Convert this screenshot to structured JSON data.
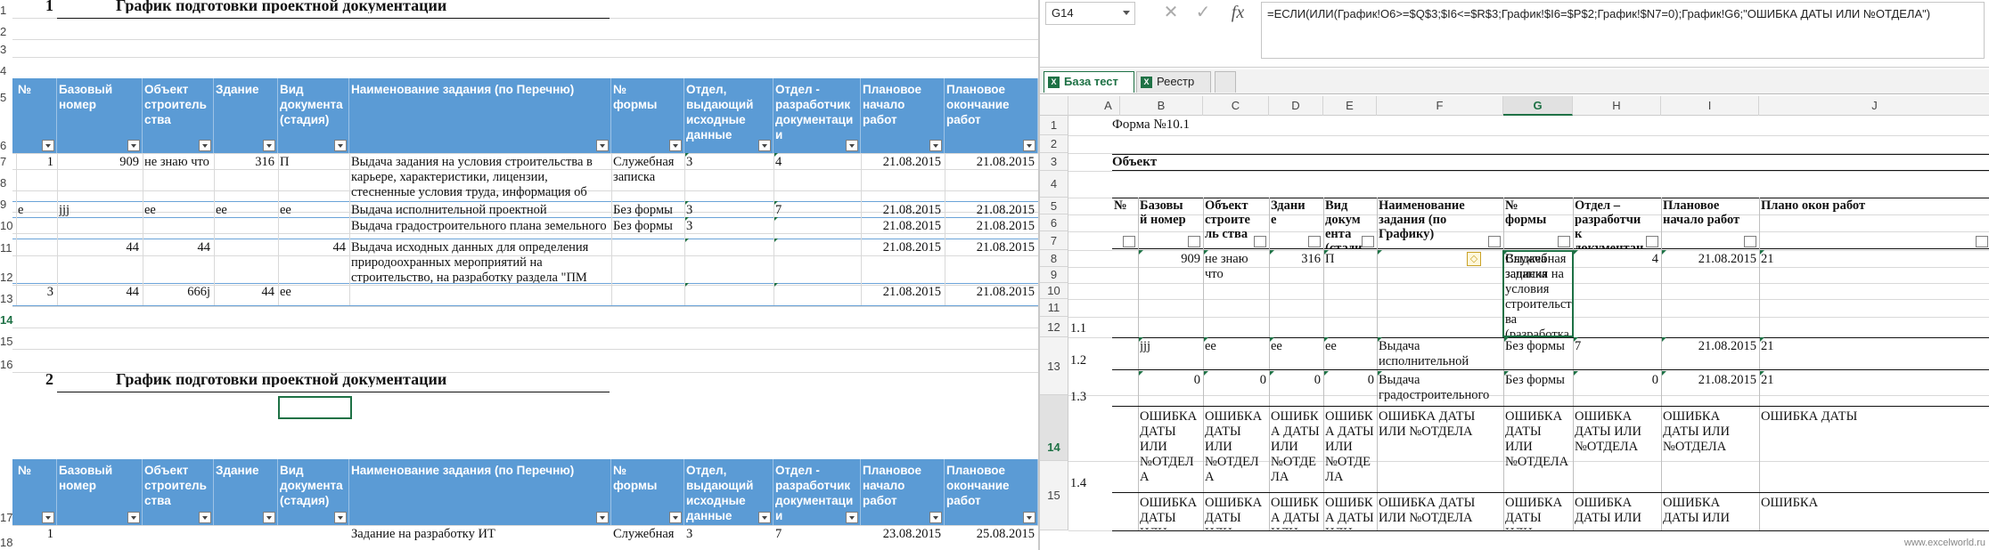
{
  "left": {
    "sections": [
      {
        "num": "1",
        "title": "График подготовки проектной документации"
      },
      {
        "num": "2",
        "title": "График подготовки проектной документации"
      }
    ],
    "row_headers": [
      "1",
      "2",
      "3",
      "4",
      "5",
      "6",
      "7",
      "8",
      "9",
      "10",
      "11",
      "12",
      "13",
      "14",
      "15",
      "16",
      "17",
      "18"
    ],
    "columns": [
      "№",
      "Базовый номер",
      "Объект строитель ства",
      "Здание",
      "Вид документа (стадия)",
      "Наименование задания (по Перечню)",
      "№ формы",
      "Отдел, выдающий исходные данные",
      "Отдел - разработчик документаци и",
      "Плановое начало работ",
      "Плановое окончание работ"
    ],
    "rows": [
      {
        "c": [
          "1",
          "909",
          "не знаю что",
          "316",
          "П",
          "Выдача задания на условия строительства в карьере, характеристики, лицензии, стесненные условия труда, информация об удаленности поставщиков местных материалов и т.д.)",
          "Служебная записка",
          "3",
          "4",
          "21.08.2015",
          "21.08.2015"
        ]
      },
      {
        "c": [
          "e",
          "jjj",
          "ee",
          "ee",
          "ee",
          "Выдача исполнительной проектной документации",
          "Без формы",
          "3",
          "7",
          "21.08.2015",
          "21.08.2015"
        ]
      },
      {
        "c": [
          "",
          "",
          "",
          "",
          "",
          "Выдача градостроительного плана земельного участка",
          "Без формы",
          "3",
          "",
          "21.08.2015",
          "21.08.2015"
        ]
      },
      {
        "c": [
          "",
          "44",
          "44",
          "",
          "44",
          "Выдача исходных данных для определения природоохранных мероприятий на строительство, на разработку раздела \"ПМ ООС\" и отчет",
          "",
          "",
          "",
          "21.08.2015",
          "21.08.2015"
        ]
      },
      {
        "c": [
          "3",
          "44",
          "666j",
          "44",
          "ee",
          "",
          "",
          "",
          "",
          "21.08.2015",
          "21.08.2015"
        ]
      }
    ],
    "last_row": {
      "c": [
        "1",
        "",
        "",
        "",
        "",
        "Задание на разработку ИТ",
        "Служебная",
        "3",
        "7",
        "23.08.2015",
        "25.08.2015"
      ]
    }
  },
  "right": {
    "name_box": "G14",
    "formula": "=ЕСЛИ(ИЛИ(График!O6>=$Q$3;$I6<=$R$3;График!$I6=$P$2;График!$N7=0);График!G6;\"ОШИБКА ДАТЫ ИЛИ №ОТДЕЛА\")",
    "fx_label": "fx",
    "tabs": [
      "База тест",
      "Реестр"
    ],
    "col_letters": [
      "A",
      "B",
      "C",
      "D",
      "E",
      "F",
      "G",
      "H",
      "I",
      "J"
    ],
    "row_headers": [
      "1",
      "2",
      "3",
      "4",
      "5",
      "6",
      "7",
      "8",
      "9",
      "10",
      "11",
      "12",
      "13",
      "14",
      "15"
    ],
    "form_label": "Форма №10.1",
    "object_label": "Объект",
    "columns": [
      "№",
      "Базовый номер",
      "Объект строитель ства",
      "Здание",
      "Вид документа (стадия)",
      "Наименование задания (по Графику)",
      "№ формы",
      "Отдел – разработчик документаци",
      "Плановое начало работ",
      "Плано окон работ"
    ],
    "rows": [
      {
        "n": "1.1",
        "c": [
          "909",
          "не знаю что",
          "316",
          "П",
          "Выдача задания на условия строительства (разработка грунта в карьере, характеристики, лицензии, стесненные условия труда, информация об удаленности поставщиков местных малов и т.д.)",
          "Служебная записка",
          "4",
          "21.08.2015",
          "21"
        ]
      },
      {
        "n": "1.2",
        "c": [
          "jjj",
          "ee",
          "ee",
          "ee",
          "Выдача исполнительной проектной документации",
          "Без формы",
          "7",
          "21.08.2015",
          "21"
        ]
      },
      {
        "n": "1.3",
        "c": [
          "0",
          "0",
          "0",
          "0",
          "Выдача градостроительного плана земельного участка",
          "Без формы",
          "0",
          "21.08.2015",
          "21"
        ]
      },
      {
        "n": "1.4",
        "c": [
          "ОШИБКА ДАТЫ ИЛИ №ОТДЕЛА",
          "ОШИБКА ДАТЫ ИЛИ №ОТДЕЛА",
          "ОШИБКА ДАТЫ ИЛИ №ОТДЕЛА",
          "ОШИБКА ДАТЫ ИЛИ №ОТДЕЛА",
          "ОШИБКА ДАТЫ ИЛИ №ОТДЕЛА",
          "ОШИБКА ДАТЫ ИЛИ №ОТДЕЛА",
          "ОШИБКА ДАТЫ ИЛИ №ОТДЕЛА",
          "ОШИБКА ДАТЫ ИЛИ №ОТДЕЛА",
          "ОШИБКА ДАТЫ"
        ]
      },
      {
        "n": "",
        "c": [
          "ОШИБКА ДАТЫ ИЛИ",
          "ОШИБКА ДАТЫ ИЛИ",
          "ОШИБКА ДАТЫ ИЛИ",
          "ОШИБКА ДАТЫ ИЛИ",
          "ОШИБКА ДАТЫ ИЛИ №ОТДЕЛА",
          "ОШИБКА ДАТЫ ИЛИ",
          "ОШИБКА ДАТЫ ИЛИ",
          "ОШИБКА ДАТЫ ИЛИ",
          "ОШИБКА"
        ]
      }
    ],
    "watermark": "www.excelworld.ru"
  },
  "colors": {
    "header_blue": "#5b9bd5",
    "excel_green": "#1e7145"
  }
}
